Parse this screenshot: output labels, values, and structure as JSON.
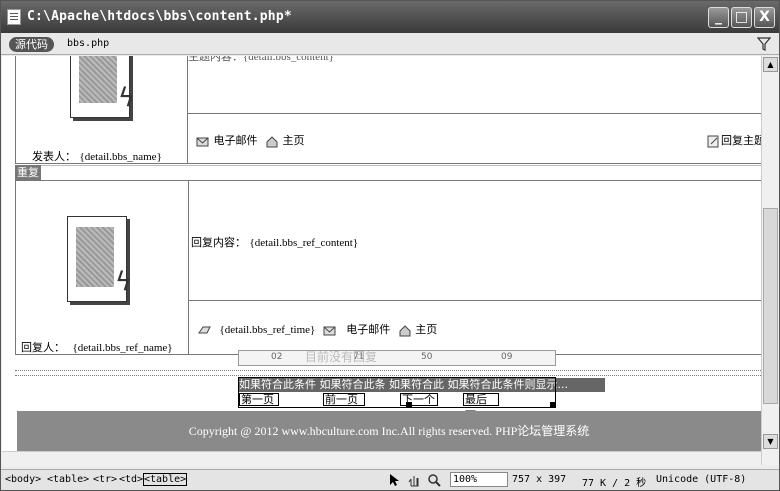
{
  "window": {
    "title": "C:\\Apache\\htdocs\\bbs\\content.php*",
    "buttons": {
      "minimize": "_",
      "maximize": "□",
      "close": "X"
    }
  },
  "toolbar": {
    "source_label": "源代码",
    "file_tab": "bbs.php"
  },
  "post": {
    "partial_content_label": "主题内容：{detail.bbs_content}",
    "poster_label": "发表人：",
    "poster_value": "{detail.bbs_name}",
    "email_label": "电子邮件",
    "home_label": "主页",
    "reply_label": "回复主题"
  },
  "reply_section": {
    "header": "重复",
    "content_label": "回复内容：",
    "content_value": "{detail.bbs_ref_content}",
    "replier_label": "回复人：",
    "replier_value": "{detail.bbs_ref_name}",
    "time_value": "{detail.bbs_ref_time}",
    "email_label": "电子邮件",
    "home_label": "主页"
  },
  "pagination": {
    "ruler_ticks": [
      "02",
      "71",
      "50",
      "09"
    ],
    "overlay_text": "目前没有回复",
    "condition_text": "如果符合此条件 如果符合此条 如果符合此 如果符合此条件则显示...",
    "first": "第一页",
    "prev": "前一页",
    "next": "下一个",
    "last": "最后一"
  },
  "footer": {
    "copyright": "Copyright @ 2012 www.hbculture.com Inc.All rights reserved. PHP论坛管理系统"
  },
  "statusbar": {
    "tags": [
      "<body>",
      "<table>",
      "<tr>",
      "<td>",
      "<table>"
    ],
    "zoom": "100%",
    "dimensions": "757 x 397",
    "size": "77 K / 2 秒",
    "encoding": "Unicode (UTF-8)"
  }
}
